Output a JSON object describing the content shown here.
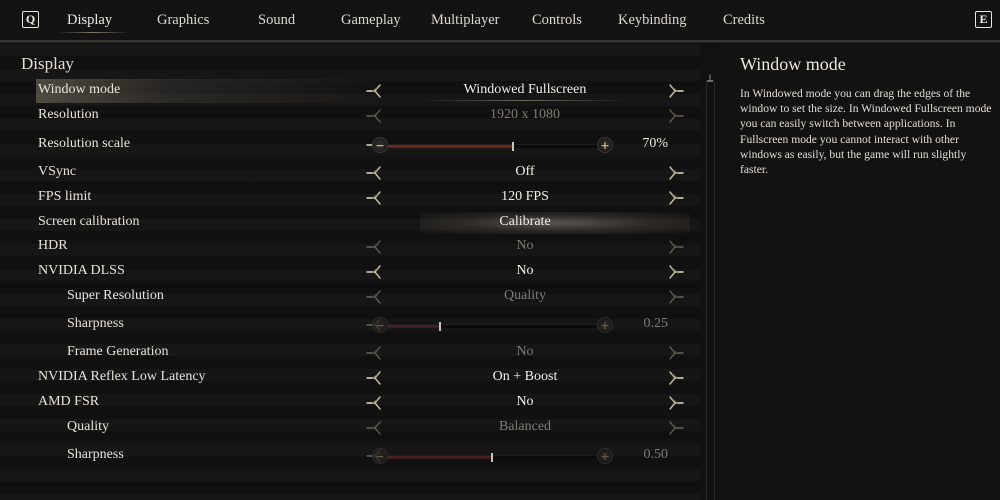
{
  "nav": {
    "left_key": "Q",
    "right_key": "E",
    "tabs": [
      {
        "label": "Display",
        "active": true
      },
      {
        "label": "Graphics",
        "active": false
      },
      {
        "label": "Sound",
        "active": false
      },
      {
        "label": "Gameplay",
        "active": false
      },
      {
        "label": "Multiplayer",
        "active": false
      },
      {
        "label": "Controls",
        "active": false
      },
      {
        "label": "Keybinding",
        "active": false
      },
      {
        "label": "Credits",
        "active": false
      }
    ]
  },
  "section": {
    "title": "Display"
  },
  "settings": [
    {
      "label": "Window mode",
      "type": "select",
      "value": "Windowed Fullscreen",
      "enabled": true,
      "selected": true
    },
    {
      "label": "Resolution",
      "type": "select",
      "value": "1920 x 1080",
      "enabled": false
    },
    {
      "label": "Resolution scale",
      "type": "slider",
      "value": "70%",
      "fraction": 0.6,
      "enabled": true
    },
    {
      "label": "VSync",
      "type": "select",
      "value": "Off",
      "enabled": true
    },
    {
      "label": "FPS limit",
      "type": "select",
      "value": "120 FPS",
      "enabled": true
    },
    {
      "label": "Screen calibration",
      "type": "button",
      "value": "Calibrate",
      "enabled": true
    },
    {
      "label": "HDR",
      "type": "select",
      "value": "No",
      "enabled": false
    },
    {
      "label": "NVIDIA DLSS",
      "type": "select",
      "value": "No",
      "enabled": true
    },
    {
      "label": "Super Resolution",
      "type": "select",
      "value": "Quality",
      "enabled": false,
      "indent": true
    },
    {
      "label": "Sharpness",
      "type": "slider",
      "value": "0.25",
      "fraction": 0.25,
      "enabled": false,
      "indent": true
    },
    {
      "label": "Frame Generation",
      "type": "select",
      "value": "No",
      "enabled": false,
      "indent": true
    },
    {
      "label": "NVIDIA Reflex Low Latency",
      "type": "select",
      "value": "On + Boost",
      "enabled": true
    },
    {
      "label": "AMD FSR",
      "type": "select",
      "value": "No",
      "enabled": true
    },
    {
      "label": "Quality",
      "type": "select",
      "value": "Balanced",
      "enabled": false,
      "indent": true
    },
    {
      "label": "Sharpness",
      "type": "slider",
      "value": "0.50",
      "fraction": 0.5,
      "enabled": false,
      "indent": true
    }
  ],
  "slider_icons": {
    "minus": "−",
    "plus": "+"
  },
  "info": {
    "title": "Window mode",
    "body": "In Windowed mode you can drag the edges of the window to set the size. In Windowed Fullscreen mode you can easily switch between applications. In Fullscreen mode you cannot interact with other windows as easily, but the game will run slightly faster."
  },
  "colors": {
    "accent_slider_fill": "#7a2a26",
    "slider_button_glyph": "#d9b070",
    "text_primary": "#ece9e2",
    "text_disabled": "#7d7a74"
  }
}
